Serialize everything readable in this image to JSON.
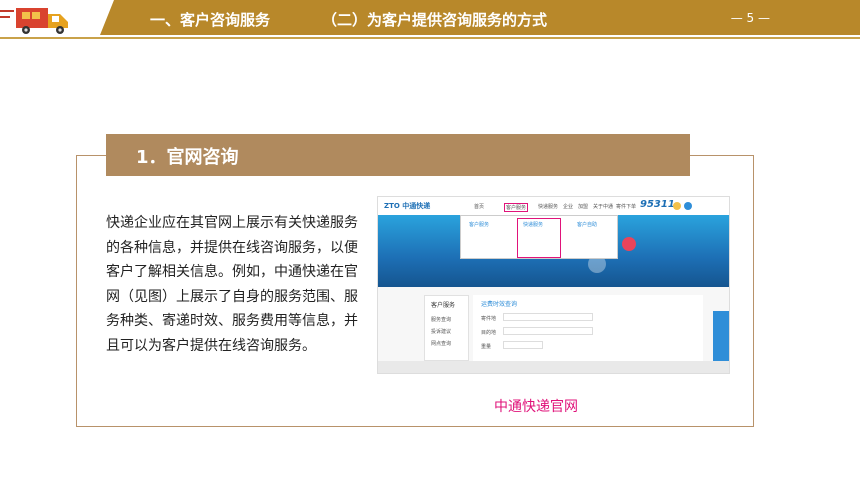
{
  "header": {
    "section_title": "一、客户咨询服务",
    "subsection_title": "（二）为客户提供咨询服务的方式",
    "page_number": "— 5 —"
  },
  "topic": {
    "title": "1．官网咨询"
  },
  "body": {
    "paragraph": "快递企业应在其官网上展示有关快递服务的各种信息，并提供在线咨询服务，以便客户了解相关信息。例如，中通快递在官网（见图）上展示了自身的服务范围、服务种类、寄递时效、服务费用等信息，并且可以为客户提供在线咨询服务。"
  },
  "screenshot": {
    "brand": "ZTO 中通快递",
    "hotline": "95311",
    "nav_items": [
      "首页",
      "客户服务",
      "快递服务",
      "企业",
      "加盟",
      "关于中通",
      "寄件下单"
    ],
    "dropdown_columns": [
      "客户服务",
      "快递服务",
      "客户自助"
    ],
    "panel_title": "客户服务",
    "panel_items": [
      "服务查询",
      "投诉建议",
      "网点查询"
    ],
    "form_title": "运费时效查询",
    "form_fields": [
      "寄件地",
      "目的地",
      "重量"
    ]
  },
  "caption": "中通快递官网",
  "colors": {
    "header_band": "#b8882a",
    "title_bar": "#b08a5e",
    "frame_border": "#b8926a",
    "caption": "#e0137a"
  }
}
